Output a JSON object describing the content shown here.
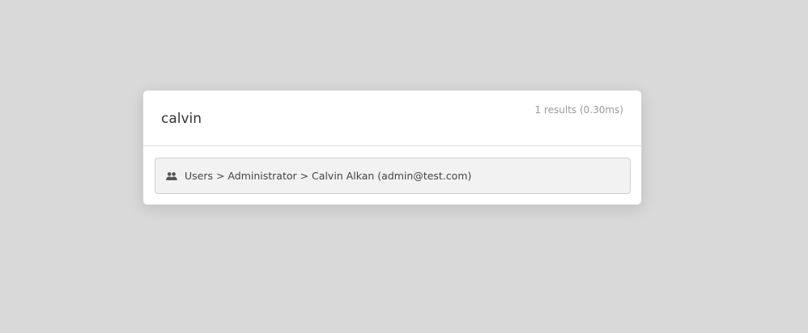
{
  "search": {
    "query": "calvin",
    "stats": "1 results (0.30ms)"
  },
  "results": [
    {
      "icon": "users-icon",
      "label": "Users > Administrator > Calvin Alkan (admin@test.com)"
    }
  ]
}
